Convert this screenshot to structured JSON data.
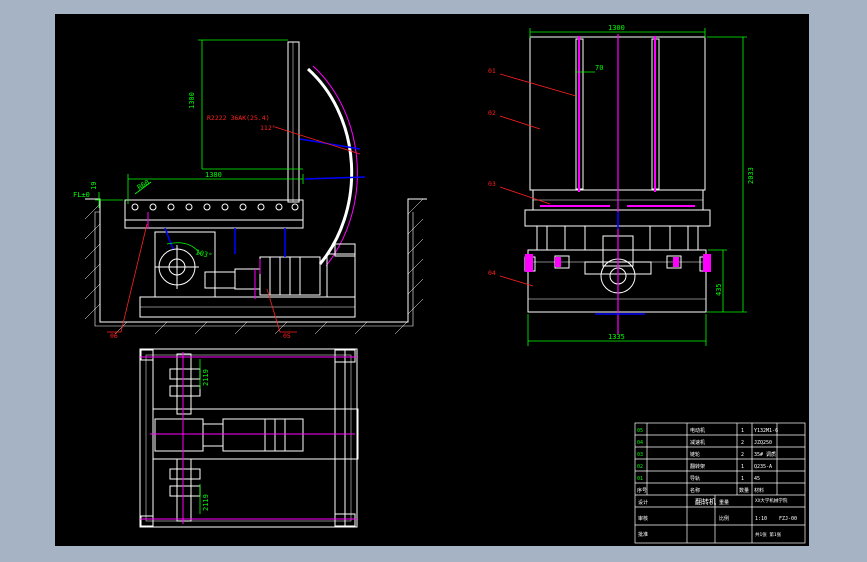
{
  "colors": {
    "bg": "#a6b3c5",
    "canvas": "#000000",
    "outline": "#ffffff",
    "dimension": "#00ff00",
    "annotation": "#ff2020",
    "centerline": "#ff00ff",
    "hydraulic": "#0000ff",
    "yellow": "#ffff00"
  },
  "side_view": {
    "height_dim": "1300",
    "length_dim": "1380",
    "level_label": "FL±0",
    "level_dim": "19",
    "small_dim": "R60",
    "angle_label": "R2222  36AK(25.4)",
    "angle_value": "112°",
    "roller_angle": "103°",
    "callouts": [
      "06",
      "05"
    ]
  },
  "front_view": {
    "width_top": "1300",
    "width_bottom": "1335",
    "height_total": "2033",
    "height_lower": "435",
    "bar_width": "70",
    "callouts": [
      "01",
      "02",
      "03",
      "04"
    ]
  },
  "plan_view": {
    "dim_top": "2119",
    "dim_bottom": "2119"
  },
  "title_block": {
    "parts": [
      {
        "no": "05",
        "name": "电动机",
        "qty": "1",
        "material": "Y132M1-6"
      },
      {
        "no": "04",
        "name": "减速机",
        "qty": "2",
        "material": "JZQ250"
      },
      {
        "no": "03",
        "name": "链轮",
        "qty": "2",
        "material": "35# 调质"
      },
      {
        "no": "02",
        "name": "翻转架",
        "qty": "1",
        "material": "Q235-A"
      },
      {
        "no": "01",
        "name": "导轨",
        "qty": "1",
        "material": "45"
      },
      {
        "no": "序号",
        "name": "名称",
        "qty": "数量",
        "material": "材料"
      }
    ],
    "drawing_title": "翻转机",
    "school": "XX大学机械学院",
    "scale": "1:10",
    "sheet": "共1张 第1张",
    "drawn_by": "设计",
    "checked_by": "审核",
    "approved_by": "批准",
    "drawing_no": "FZJ-00",
    "weight": "重量",
    "ratio": "比例"
  }
}
